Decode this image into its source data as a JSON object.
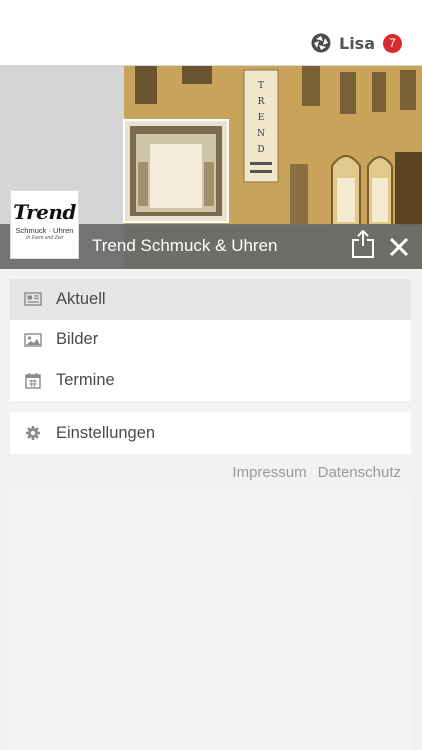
{
  "top_bar": {
    "user_name": "Lisa",
    "notification_count": "7",
    "user_icon": "app-logo-icon"
  },
  "header": {
    "title": "Trend Schmuck & Uhren",
    "logo": {
      "name": "Trend",
      "subtitle": "Schmuck · Uhren",
      "tagline": "In Form und Zeit"
    },
    "share_icon": "share-icon",
    "close_icon": "close-icon"
  },
  "menu": {
    "items": [
      {
        "label": "Aktuell",
        "icon": "newspaper-icon",
        "active": true
      },
      {
        "label": "Bilder",
        "icon": "image-icon",
        "active": false
      },
      {
        "label": "Termine",
        "icon": "calendar-icon",
        "active": false
      }
    ],
    "settings": {
      "label": "Einstellungen",
      "icon": "gear-icon"
    }
  },
  "footer": {
    "impressum": "Impressum",
    "datenschutz": "Datenschutz"
  },
  "colors": {
    "badge": "#d92b2b",
    "title_bar": "#6c6c6c",
    "active_item": "#e6e6e6",
    "background": "#f2f2f2"
  }
}
